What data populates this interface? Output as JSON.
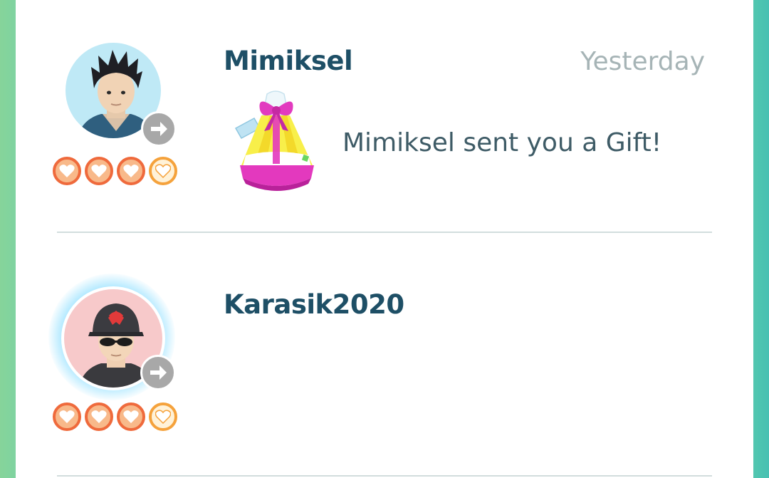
{
  "notifications": [
    {
      "friend_name": "Mimiksel",
      "time": "Yesterday",
      "message": "Mimiksel sent you a Gift!",
      "friendship_hearts_filled": 3,
      "friendship_hearts_total": 4,
      "avatar_icon": "trainer-avatar-spiky-hair",
      "action_icon": "arrow-right-icon",
      "item_icon": "gift-icon"
    },
    {
      "friend_name": "Karasik2020",
      "friendship_hearts_filled": 3,
      "friendship_hearts_total": 4,
      "avatar_icon": "trainer-avatar-cap-sunglasses",
      "action_icon": "arrow-right-icon"
    }
  ],
  "colors": {
    "name": "#1e4f66",
    "time": "#a6b4b6",
    "message": "#3e5b66",
    "heart_filled": "#ef6a3c",
    "heart_outline": "#f5a23c",
    "gift_ribbon": "#e23bbf",
    "gift_body": "#f8ef4a"
  }
}
